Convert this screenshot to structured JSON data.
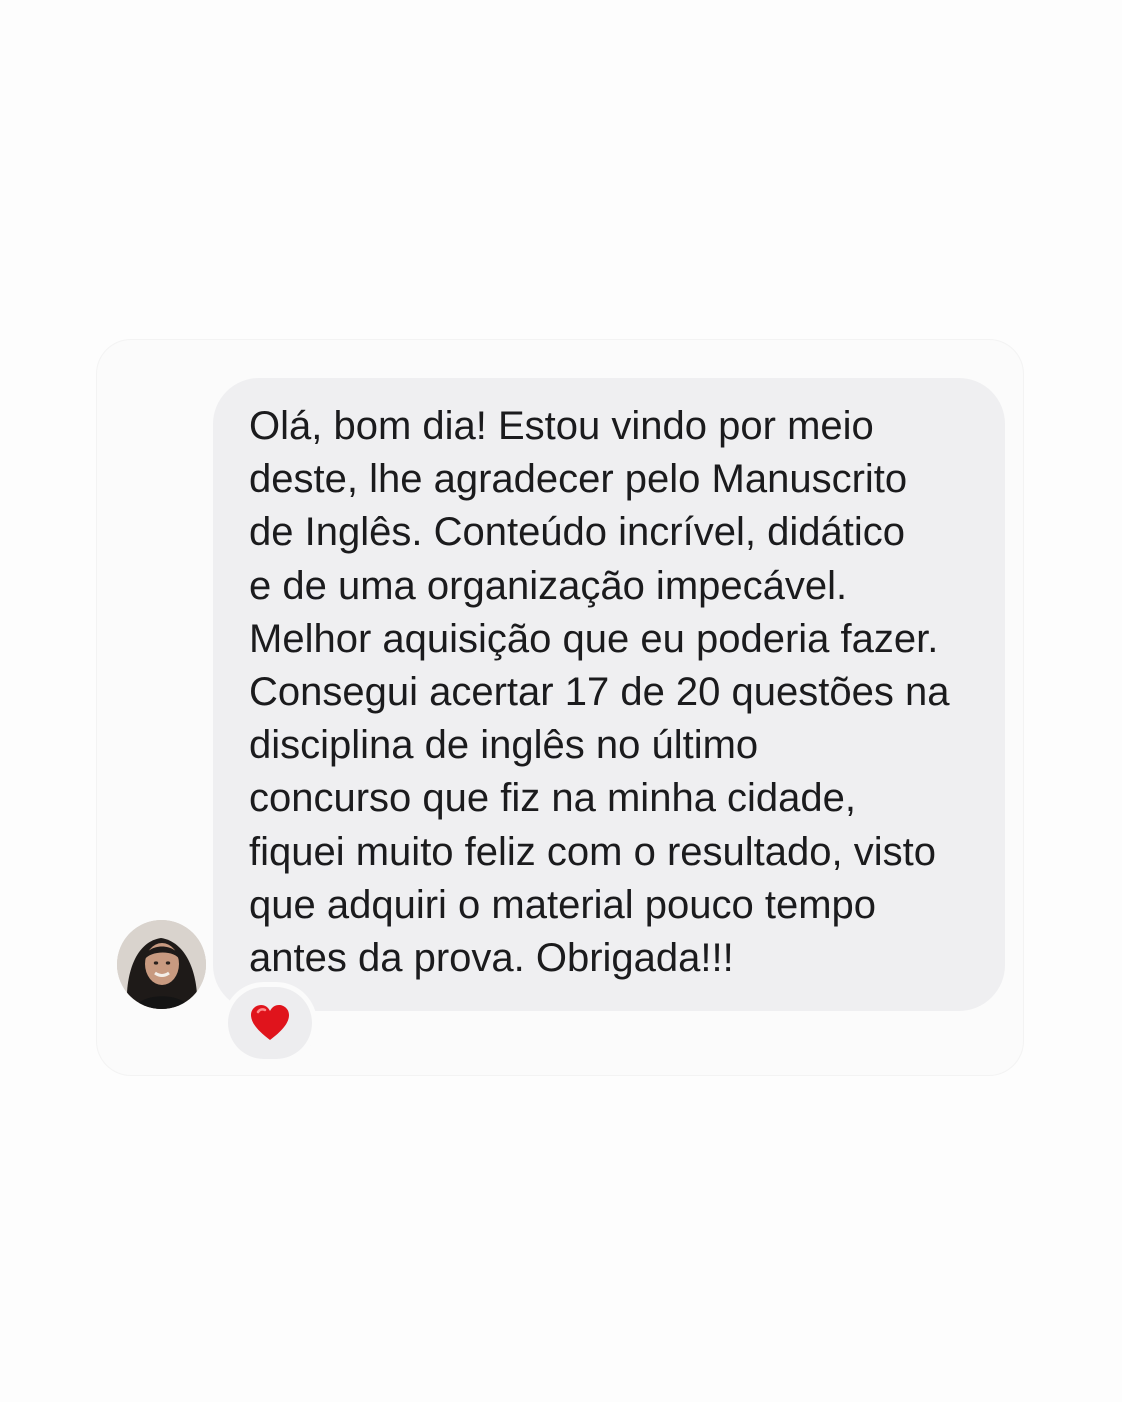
{
  "message": {
    "lines": [
      "Olá, bom dia! Estou vindo por meio",
      "deste, lhe agradecer pelo Manuscrito",
      "de Inglês. Conteúdo incrível, didático",
      "e de uma organização impecável.",
      "Melhor aquisição que eu poderia fazer.",
      "Consegui acertar 17 de 20 questões na",
      "disciplina de inglês no último",
      "concurso que fiz na minha cidade,",
      "fiquei muito feliz com o resultado, visto",
      "que adquiri o material pouco tempo",
      "antes da prova. Obrigada!!!"
    ]
  },
  "reaction": {
    "icon": "red-heart-icon",
    "color": "#e0141c"
  },
  "colors": {
    "bubble": "#efeff1",
    "card": "#fbfbfb",
    "text": "#1b1b1d"
  }
}
